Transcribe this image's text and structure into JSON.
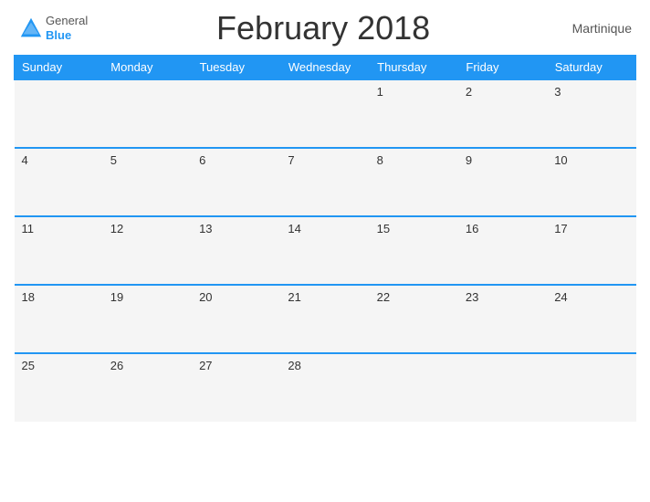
{
  "header": {
    "title": "February 2018",
    "location": "Martinique",
    "logo_general": "General",
    "logo_blue": "Blue"
  },
  "days_of_week": [
    "Sunday",
    "Monday",
    "Tuesday",
    "Wednesday",
    "Thursday",
    "Friday",
    "Saturday"
  ],
  "weeks": [
    [
      "",
      "",
      "",
      "",
      "1",
      "2",
      "3"
    ],
    [
      "4",
      "5",
      "6",
      "7",
      "8",
      "9",
      "10"
    ],
    [
      "11",
      "12",
      "13",
      "14",
      "15",
      "16",
      "17"
    ],
    [
      "18",
      "19",
      "20",
      "21",
      "22",
      "23",
      "24"
    ],
    [
      "25",
      "26",
      "27",
      "28",
      "",
      "",
      ""
    ]
  ]
}
